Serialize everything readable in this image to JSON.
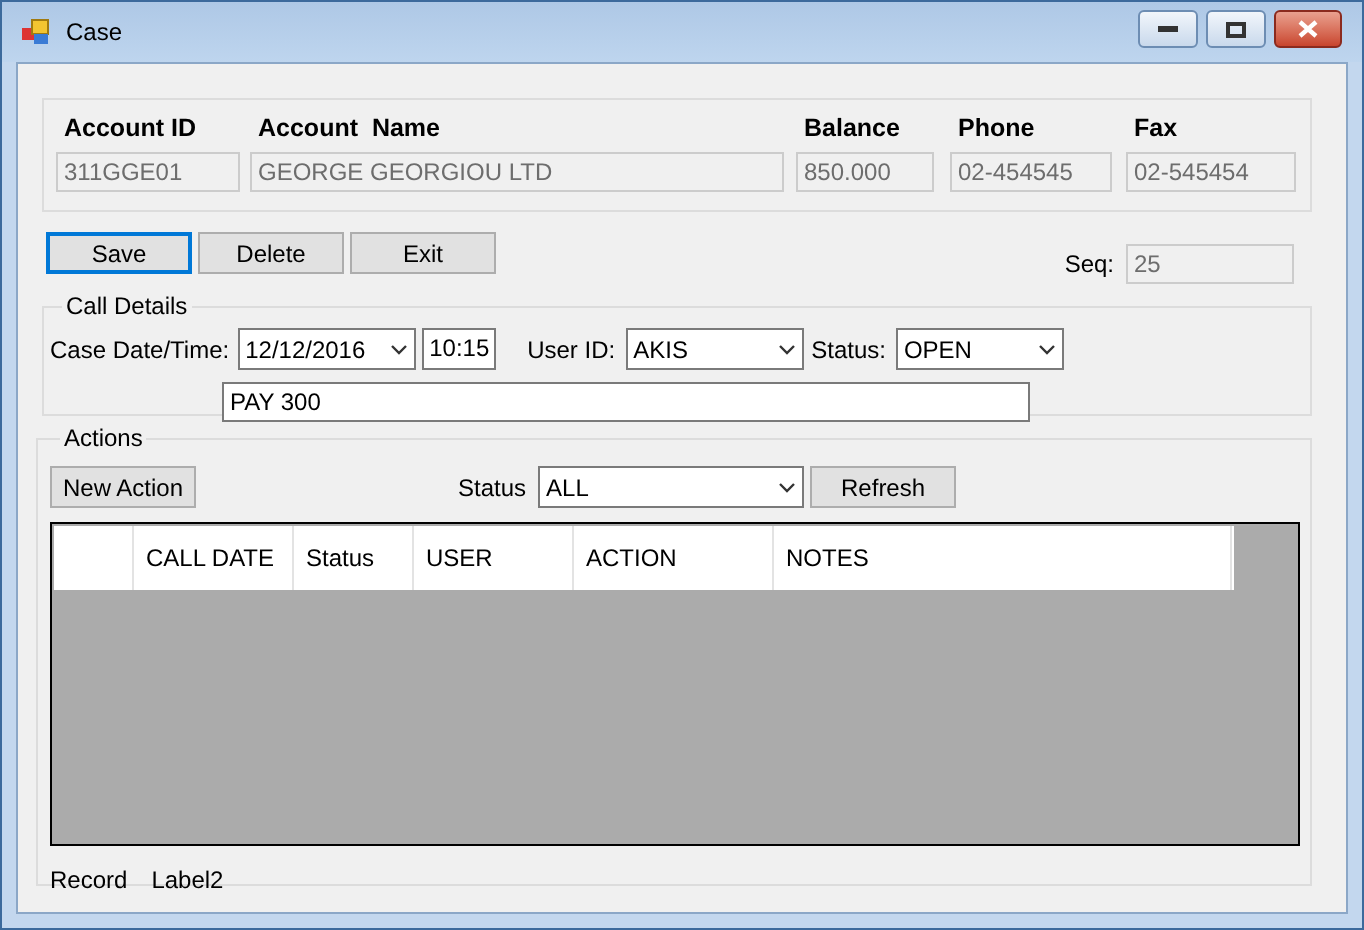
{
  "window": {
    "title": "Case"
  },
  "account": {
    "fields": [
      {
        "label": "Account ID",
        "value": "311GGE01",
        "disabled": true
      },
      {
        "label": "Account  Name",
        "value": "GEORGE GEORGIOU LTD",
        "disabled": true
      },
      {
        "label": "Balance",
        "value": "850.000",
        "disabled": true
      },
      {
        "label": "Phone",
        "value": "02-454545",
        "disabled": true
      },
      {
        "label": "Fax",
        "value": "02-545454",
        "disabled": true
      }
    ]
  },
  "buttons": [
    {
      "label": "Save",
      "focused": true
    },
    {
      "label": "Delete",
      "focused": false
    },
    {
      "label": "Exit",
      "focused": false
    }
  ],
  "seq": {
    "label": "Seq:",
    "value": "25",
    "disabled": true
  },
  "call_details": {
    "title": "Call Details",
    "date_label": "Case Date/Time:",
    "date": "12/12/2016",
    "time": "10:15",
    "user_label": "User ID:",
    "user": "AKIS",
    "status_label": "Status:",
    "status": "OPEN",
    "notes": "PAY 300"
  },
  "actions": {
    "title": "Actions",
    "new_action": "New Action",
    "status_label": "Status",
    "status_filter": "ALL",
    "refresh": "Refresh",
    "grid": {
      "columns": [
        "",
        "CALL DATE",
        "Status",
        "USER",
        "ACTION",
        "NOTES"
      ]
    },
    "footer": [
      "Record",
      "Label2"
    ]
  }
}
